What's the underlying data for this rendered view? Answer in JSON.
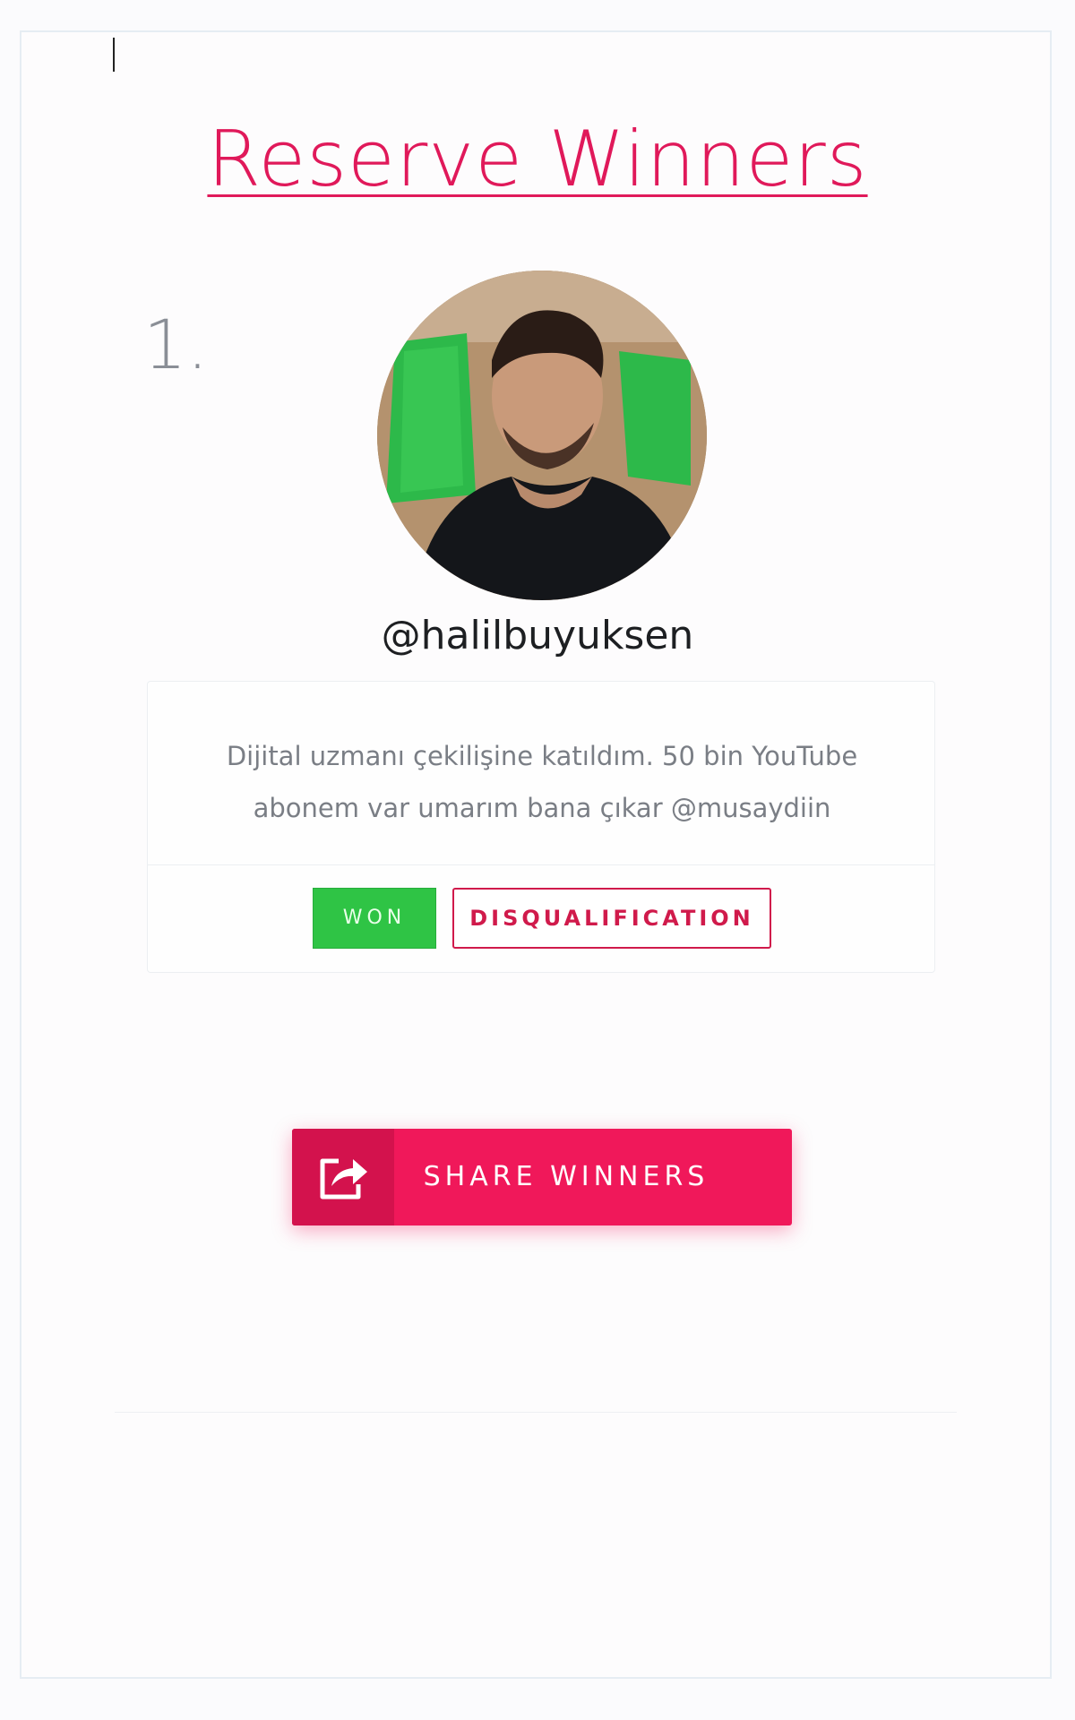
{
  "page": {
    "title": "Reserve Winners"
  },
  "winner": {
    "rank": "1.",
    "username": "@halilbuyuksen",
    "comment": "Dijital uzmanı çekilişine katıldım. 50 bin YouTube abonem var umarım bana çıkar @musaydiin",
    "won_label": "WON",
    "disqualify_label": "DISQUALIFICATION"
  },
  "share": {
    "label": "SHARE WINNERS",
    "icon": "share-icon"
  },
  "colors": {
    "accent": "#e0195a",
    "won": "#2fc445",
    "share_button": "#f0185a"
  }
}
